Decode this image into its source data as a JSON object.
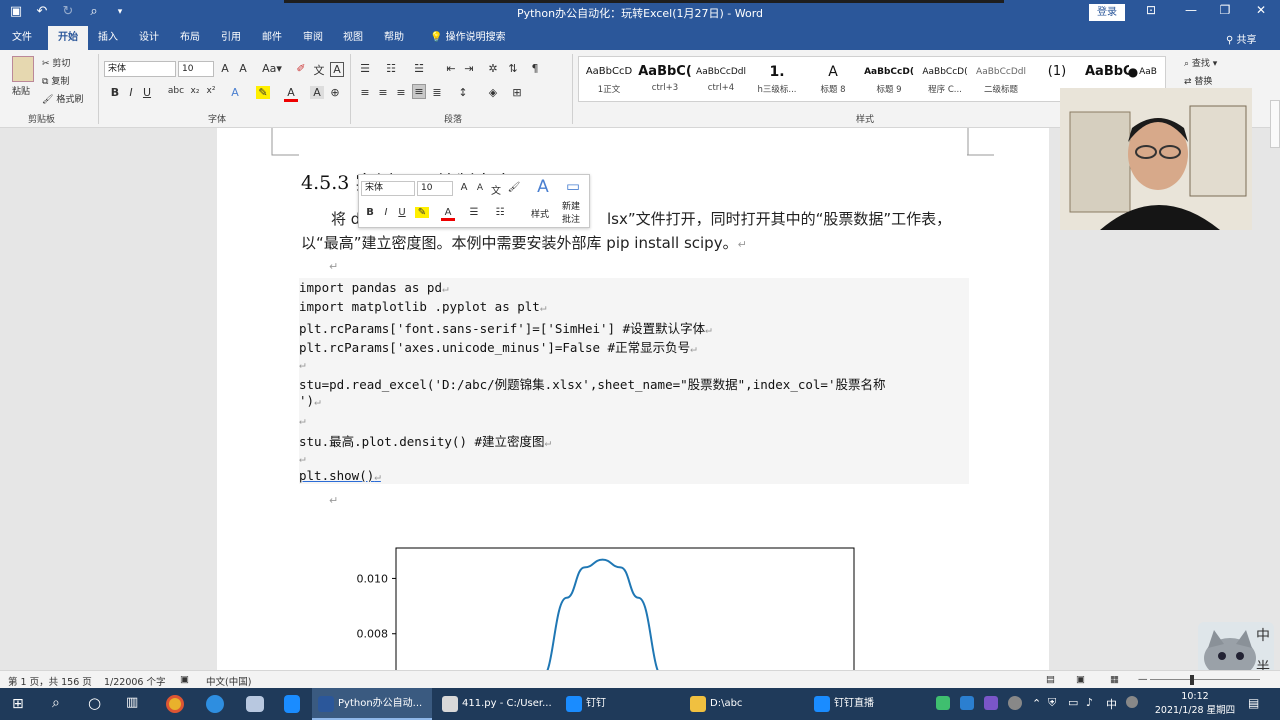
{
  "window": {
    "doc_title": "Python办公自动化：玩转Excel(1月27日)  -  Word",
    "login_label": "登录"
  },
  "tabs": [
    "文件",
    "开始",
    "插入",
    "设计",
    "布局",
    "引用",
    "邮件",
    "审阅",
    "视图",
    "帮助"
  ],
  "active_tab": "开始",
  "tell_me": "操作说明搜索",
  "share_label": "共享",
  "ribbon": {
    "clipboard": {
      "paste": "粘贴",
      "cut": "剪切",
      "copy": "复制",
      "format_painter": "格式刷",
      "group_label": "剪贴板"
    },
    "font": {
      "font_name": "宋体",
      "font_size": "10",
      "group_label": "字体"
    },
    "paragraph": {
      "group_label": "段落"
    },
    "styles": {
      "group_label": "样式",
      "items": [
        {
          "preview": "AaBbCcD",
          "name": "1正文"
        },
        {
          "preview": "AaBbC(",
          "name": "ctrl+3"
        },
        {
          "preview": "AaBbCcDdl",
          "name": "ctrl+4"
        },
        {
          "preview": "1.",
          "name": "h三级标..."
        },
        {
          "preview": "A",
          "name": "标题 8"
        },
        {
          "preview": "AaBbCcD(",
          "name": "标题 9"
        },
        {
          "preview": "AaBbCcD(",
          "name": "程序 C..."
        },
        {
          "preview": "AaBbCcDdl",
          "name": "二级标题"
        },
        {
          "preview": "(1)",
          "name": ""
        },
        {
          "preview": "AaBbC",
          "name": ""
        },
        {
          "preview": "AaB",
          "name": ""
        }
      ]
    },
    "editing": {
      "find": "查找",
      "replace": "替换"
    }
  },
  "document": {
    "heading": "4.5.3  实例11：绘制密度图",
    "para1_start": "将 d",
    "para1_end": "lsx”文件打开，同时打开其中的“股票数据”工作表，",
    "para2": "以“最高”建立密度图。本例中需要安装外部库 pip install scipy。",
    "code_lines": [
      "import pandas as pd",
      "import matplotlib .pyplot as plt",
      "plt.rcParams['font.sans-serif']=['SimHei']     #设置默认字体",
      "plt.rcParams['axes.unicode_minus']=False       #正常显示负号",
      "",
      "stu=pd.read_excel('D:/abc/例题锦集.xlsx',sheet_name=\"股票数据\",index_col='股票名称",
      "')",
      "",
      "stu.最高.plot.density()       #建立密度图",
      "",
      "plt.show()"
    ]
  },
  "mini_toolbar": {
    "font_name": "宋体",
    "font_size": "10",
    "styles_label": "样式",
    "new_comment_label1": "新建",
    "new_comment_label2": "批注"
  },
  "chart_data": {
    "type": "line",
    "title": "",
    "xlabel": "",
    "ylabel": "",
    "yticks": [
      "0.010",
      "0.008"
    ],
    "ylim": [
      0.0064,
      0.0111
    ],
    "series": [
      {
        "name": "",
        "x": [
          -0.34,
          -0.2,
          -0.1,
          0,
          0.1,
          0.2,
          0.34
        ],
        "y": [
          0.0064,
          0.0093,
          0.0104,
          0.01068,
          0.0104,
          0.0093,
          0.0064
        ],
        "color": "#1f77b4"
      }
    ],
    "xlim": [
      -1.15,
      1.4
    ]
  },
  "statusbar": {
    "page": "第 1 页，共 156 页",
    "words": "1/22006 个字",
    "language": "中文(中国)"
  },
  "taskbar": {
    "apps": [
      {
        "label": "Python办公自动...",
        "color": "#2b579a"
      },
      {
        "label": "411.py - C:/User...",
        "color": "#d8d8d8"
      },
      {
        "label": "钉钉",
        "color": "#1a8cff"
      },
      {
        "label": "D:\\abc",
        "color": "#f0c040"
      },
      {
        "label": "钉钉直播",
        "color": "#1a8cff"
      }
    ],
    "time": "10:12",
    "date": "2021/1/28 星期四",
    "ime": "中"
  }
}
